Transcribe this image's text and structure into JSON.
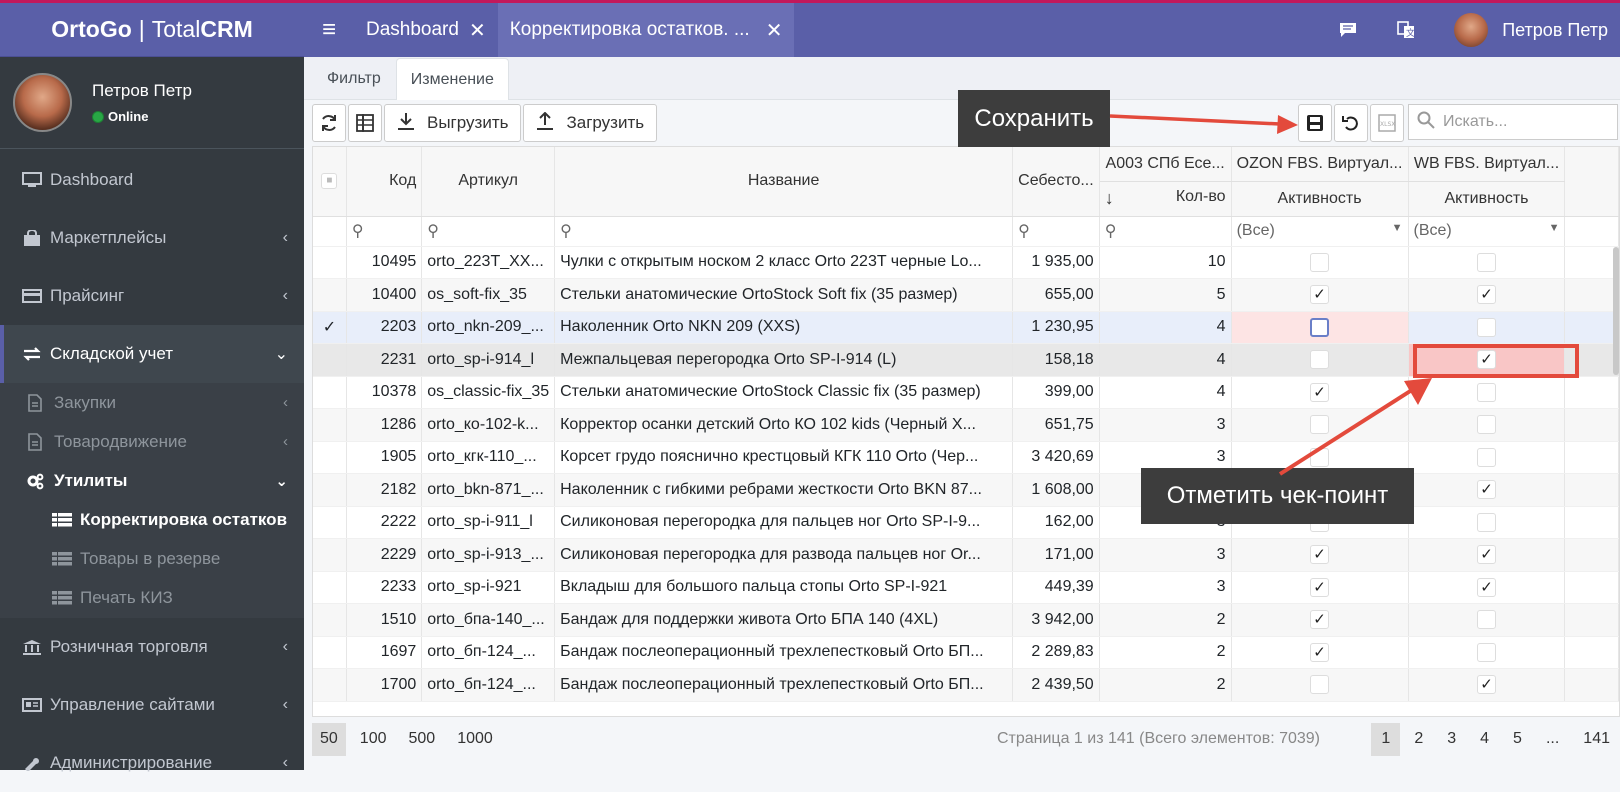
{
  "brand": {
    "part1": "OrtoGo",
    "part2": "Total",
    "part3": "CRM"
  },
  "user": {
    "name": "Петров Петр",
    "status": "Online"
  },
  "sidebar": {
    "items": [
      {
        "label": "Dashboard",
        "icon": "monitor-icon"
      },
      {
        "label": "Маркетплейсы",
        "icon": "shopping-bag-icon"
      },
      {
        "label": "Прайсинг",
        "icon": "credit-card-icon"
      },
      {
        "label": "Складской учет",
        "icon": "exchange-icon"
      }
    ],
    "sub": [
      {
        "label": "Закупки"
      },
      {
        "label": "Товародвижение"
      },
      {
        "label": "Утилиты"
      }
    ],
    "sub2": [
      {
        "label": "Корректировка остатков"
      },
      {
        "label": "Товары в резерве"
      },
      {
        "label": "Печать КИЗ"
      }
    ],
    "bottom": [
      {
        "label": "Розничная торговля"
      },
      {
        "label": "Управление сайтами"
      },
      {
        "label": "Администрирование"
      }
    ]
  },
  "topbar": {
    "tabs": [
      {
        "label": "Dashboard"
      },
      {
        "label": "Корректировка остатков. ..."
      }
    ],
    "user": "Петров Петр"
  },
  "subtabs": [
    {
      "label": "Фильтр"
    },
    {
      "label": "Изменение"
    }
  ],
  "toolbar": {
    "export": "Выгрузить",
    "import": "Загрузить",
    "search_placeholder": "Искать..."
  },
  "grid": {
    "headers": {
      "code": "Код",
      "article": "Артикул",
      "name": "Название",
      "cost": "Себесто...",
      "wh": "А003 СПб Есе...",
      "qty": "Кол-во",
      "ozon": "OZON FBS. Виртуал...",
      "ozon_sub": "Активность",
      "wb": "WB FBS. Виртуал...",
      "wb_sub": "Активность",
      "all1": "(Все)",
      "all2": "(Все)"
    },
    "rows": [
      {
        "code": "10495",
        "article": "orto_223T_XX...",
        "name": "Чулки с открытым носком 2 класс Orto 223T черные Lo...",
        "cost": "1 935,00",
        "qty": "10",
        "ozon": false,
        "wb": false
      },
      {
        "code": "10400",
        "article": "os_soft-fix_35",
        "name": "Стельки анатомические OrtoStock Soft fix (35 размер)",
        "cost": "655,00",
        "qty": "5",
        "ozon": true,
        "wb": true
      },
      {
        "code": "2203",
        "article": "orto_nkn-209_...",
        "name": "Наколенник Orto NKN 209 (XXS)",
        "cost": "1 230,95",
        "qty": "4",
        "ozon": false,
        "wb": false
      },
      {
        "code": "2231",
        "article": "orto_sp-i-914_l",
        "name": "Межпальцевая перегородка Orto SP-I-914 (L)",
        "cost": "158,18",
        "qty": "4",
        "ozon": false,
        "wb": true
      },
      {
        "code": "10378",
        "article": "os_classic-fix_35",
        "name": "Стельки анатомические OrtoStock Classic fix (35 размер)",
        "cost": "399,00",
        "qty": "4",
        "ozon": true,
        "wb": false
      },
      {
        "code": "1286",
        "article": "orto_ко-102-k...",
        "name": "Корректор осанки детский Orto КО 102 kids (Черный Х...",
        "cost": "651,75",
        "qty": "3",
        "ozon": false,
        "wb": false
      },
      {
        "code": "1905",
        "article": "orto_кгк-110_...",
        "name": "Корсет грудо пояснично крестцовый КГК 110 Orto (Чер...",
        "cost": "3 420,69",
        "qty": "3",
        "ozon": false,
        "wb": false
      },
      {
        "code": "2182",
        "article": "orto_bkn-871_...",
        "name": "Наколенник с гибкими ребрами жесткости Orto BKN 87...",
        "cost": "1 608,00",
        "qty": "3",
        "ozon": false,
        "wb": true
      },
      {
        "code": "2222",
        "article": "orto_sp-i-911_l",
        "name": "Силиконовая перегородка для пальцев ног Orto SP-I-9...",
        "cost": "162,00",
        "qty": "3",
        "ozon": false,
        "wb": false
      },
      {
        "code": "2229",
        "article": "orto_sp-i-913_...",
        "name": "Силиконовая перегородка для развода пальцев ног Or...",
        "cost": "171,00",
        "qty": "3",
        "ozon": true,
        "wb": true
      },
      {
        "code": "2233",
        "article": "orto_sp-i-921",
        "name": "Вкладыш для большого пальца стопы Orto SP-I-921",
        "cost": "449,39",
        "qty": "3",
        "ozon": true,
        "wb": true
      },
      {
        "code": "1510",
        "article": "orto_бпа-140_...",
        "name": "Бандаж для поддержки живота Orto БПА 140 (4XL)",
        "cost": "3 942,00",
        "qty": "2",
        "ozon": true,
        "wb": false
      },
      {
        "code": "1697",
        "article": "orto_бп-124_...",
        "name": "Бандаж послеоперационный трехлепестковый Orto БП...",
        "cost": "2 289,83",
        "qty": "2",
        "ozon": true,
        "wb": false
      },
      {
        "code": "1700",
        "article": "orto_бп-124_...",
        "name": "Бандаж послеоперационный трехлепестковый Orto БП...",
        "cost": "2 439,50",
        "qty": "2",
        "ozon": false,
        "wb": true
      }
    ]
  },
  "footer": {
    "sizes": [
      "50",
      "100",
      "500",
      "1000"
    ],
    "info": "Страница 1 из 141 (Всего элементов: 7039)",
    "pages": [
      "1",
      "2",
      "3",
      "4",
      "5",
      "...",
      "141"
    ]
  },
  "callouts": {
    "save": "Сохранить",
    "checkpoint": "Отметить чек-поинт"
  }
}
